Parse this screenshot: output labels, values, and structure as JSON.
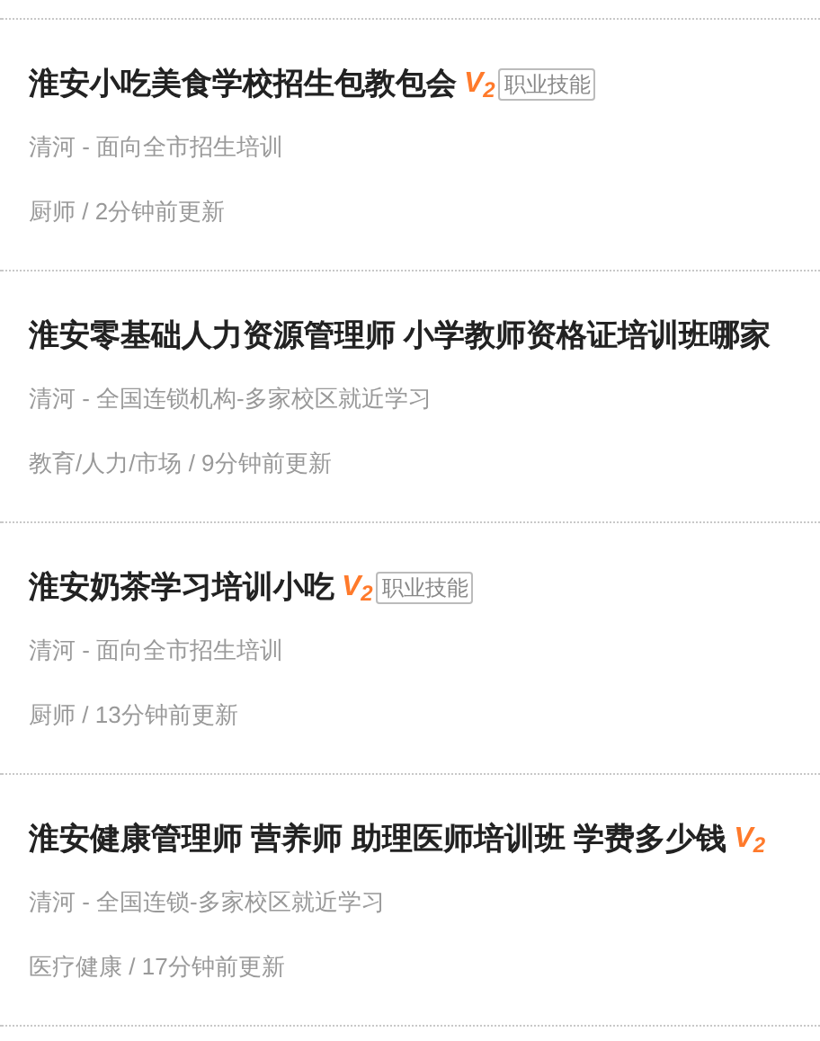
{
  "listings": [
    {
      "title": "淮安小吃美食学校招生包教包会",
      "badge": "V$_{2}$",
      "tag": "职业技能",
      "location": "清河 - 面向全市招生培训",
      "meta": "厨师 / 2分钟前更新"
    },
    {
      "title": "淮安零基础人力资源管理师 小学教师资格证培训班哪家",
      "location": "清河 - 全国连锁机构-多家校区就近学习",
      "meta": "教育/人力/市场 / 9分钟前更新"
    },
    {
      "title": "淮安奶茶学习培训小吃",
      "badge": "V$_{2}$",
      "tag": "职业技能",
      "location": "清河 - 面向全市招生培训",
      "meta": "厨师 / 13分钟前更新"
    },
    {
      "title": "淮安健康管理师 营养师 助理医师培训班 学费多少钱",
      "badge": "V$_{2}$",
      "location": "清河 - 全国连锁-多家校区就近学习",
      "meta": "医疗健康 / 17分钟前更新"
    }
  ]
}
